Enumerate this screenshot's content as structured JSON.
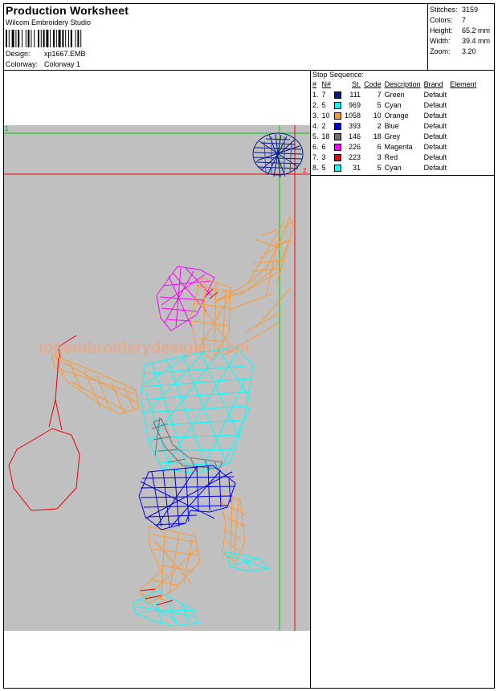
{
  "header": {
    "title": "Production Worksheet",
    "software": "Wilcom Embroidery Studio",
    "design_label": "Design:",
    "design_value": "xp1667.EMB",
    "colorway_label": "Colorway:",
    "colorway_value": "Colorway 1"
  },
  "stats": [
    {
      "label": "Stitches:",
      "value": "3159"
    },
    {
      "label": "Colors:",
      "value": "7"
    },
    {
      "label": "Height:",
      "value": "65.2 mm"
    },
    {
      "label": "Width:",
      "value": "39.4 mm"
    },
    {
      "label": "Zoom:",
      "value": "3.20"
    }
  ],
  "stop_sequence": {
    "title": "Stop Sequence:",
    "columns": [
      "#",
      "N#",
      "St.",
      "Code",
      "Description",
      "Brand",
      "Element"
    ],
    "rows": [
      {
        "num": "1.",
        "n": "7",
        "color": "#0a1a80",
        "st": "111",
        "code": "7",
        "desc": "Green",
        "brand": "Default"
      },
      {
        "num": "2.",
        "n": "5",
        "color": "#00ffff",
        "st": "969",
        "code": "5",
        "desc": "Cyan",
        "brand": "Default"
      },
      {
        "num": "3.",
        "n": "10",
        "color": "#ff9933",
        "st": "1058",
        "code": "10",
        "desc": "Orange",
        "brand": "Default"
      },
      {
        "num": "4.",
        "n": "2",
        "color": "#0000ee",
        "st": "393",
        "code": "2",
        "desc": "Blue",
        "brand": "Default"
      },
      {
        "num": "5.",
        "n": "18",
        "color": "#707070",
        "st": "146",
        "code": "18",
        "desc": "Grey",
        "brand": "Default"
      },
      {
        "num": "6.",
        "n": "6",
        "color": "#ff00ff",
        "st": "226",
        "code": "6",
        "desc": "Magenta",
        "brand": "Default"
      },
      {
        "num": "7.",
        "n": "3",
        "color": "#ee0000",
        "st": "223",
        "code": "3",
        "desc": "Red",
        "brand": "Default"
      },
      {
        "num": "8.",
        "n": "5",
        "color": "#00ffff",
        "st": "31",
        "code": "5",
        "desc": "Cyan",
        "brand": "Default"
      }
    ]
  },
  "design_preview": {
    "watermark": "topembroiderydesigns.com",
    "guide_label_left": "1",
    "guide_label_right": "2"
  }
}
